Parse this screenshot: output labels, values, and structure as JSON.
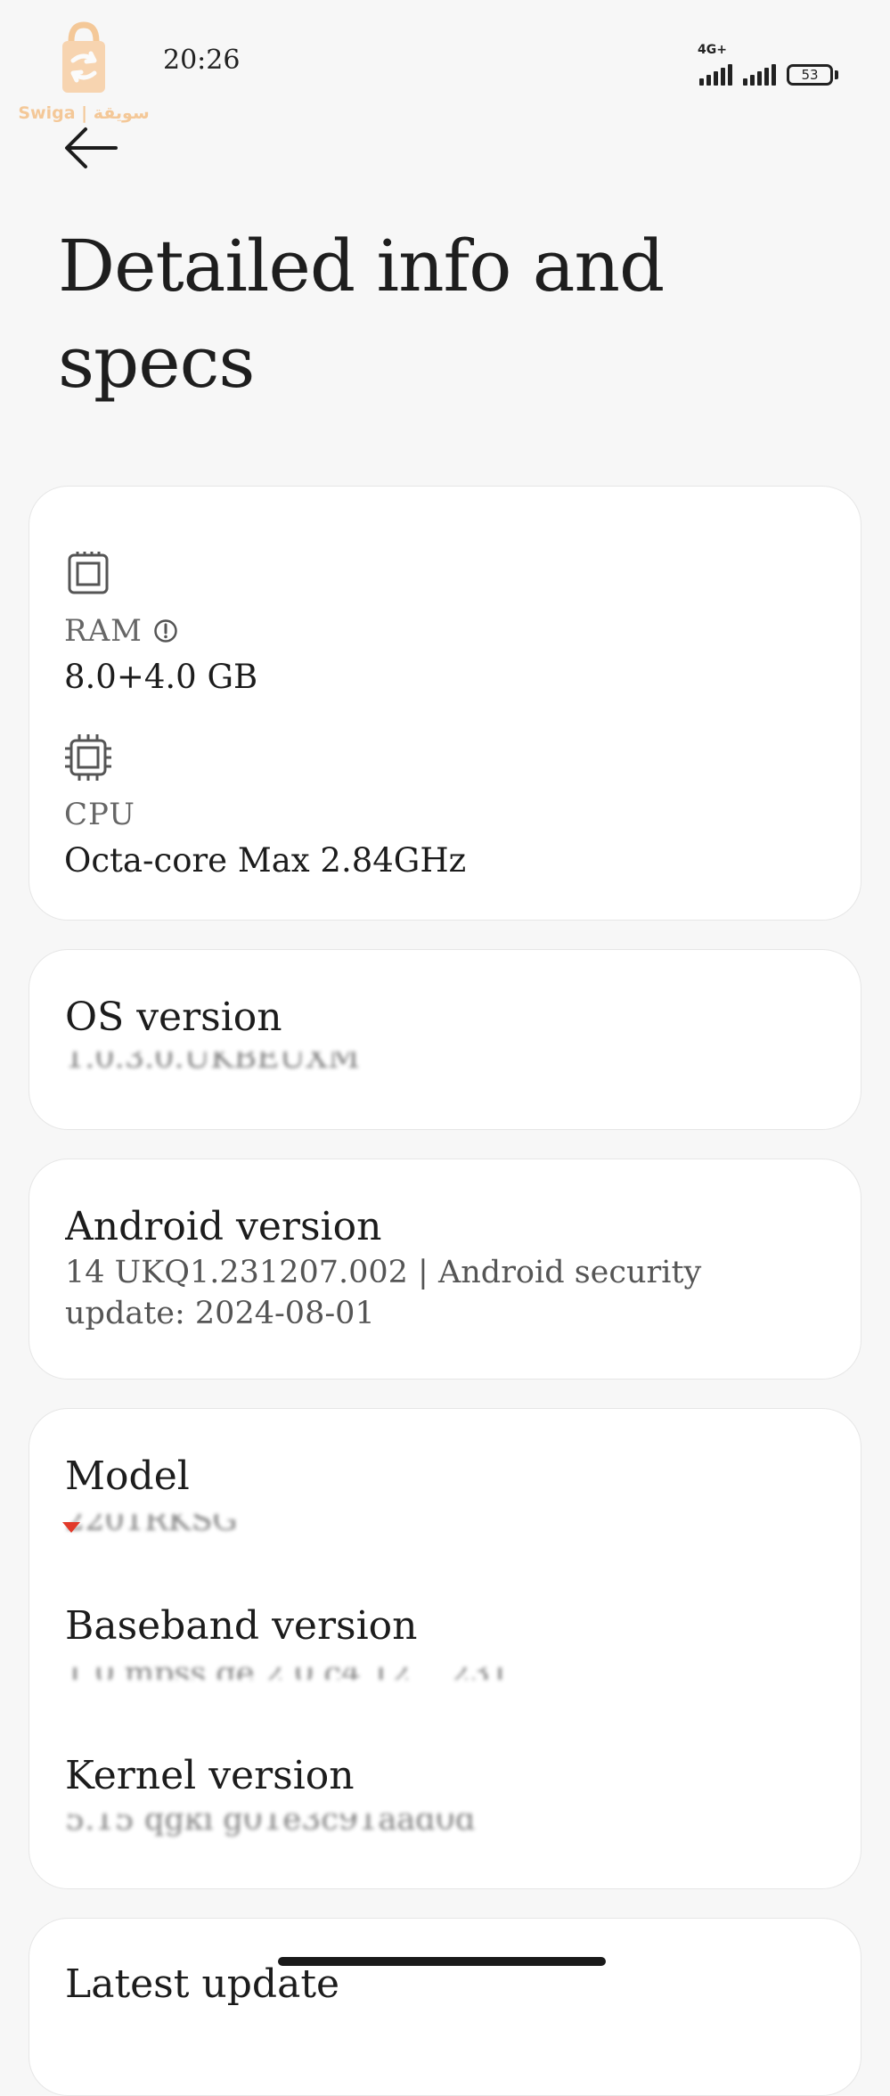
{
  "status_bar": {
    "time": "20:26",
    "network": "4G+",
    "battery": "53"
  },
  "watermark": {
    "text": "Swiga | سويقة"
  },
  "page": {
    "title_line1": "Detailed info and",
    "title_line2": "specs"
  },
  "hardware": {
    "ram_label": "RAM",
    "ram_value": "8.0+4.0 GB",
    "cpu_label": "CPU",
    "cpu_value": "Octa-core Max 2.84GHz"
  },
  "os": {
    "label": "OS version",
    "value": "1.0.3.0.UKBEUXM"
  },
  "android": {
    "label": "Android version",
    "value": "14 UKQ1.231207.002 | Android security update: 2024-08-01"
  },
  "details": {
    "model_label": "Model",
    "model_value": "2201RKSG",
    "baseband_label": "Baseband version",
    "baseband_value": "1.0 mpss.ge 2.0 c4 12 ...231",
    "kernel_label": "Kernel version",
    "kernel_value": "5.15 qgki g01e3c91aad0d"
  },
  "last_card": {
    "label": "Latest update"
  },
  "colors": {
    "background": "#f7f7f7",
    "card": "#ffffff",
    "watermark": "#f2a24b"
  }
}
